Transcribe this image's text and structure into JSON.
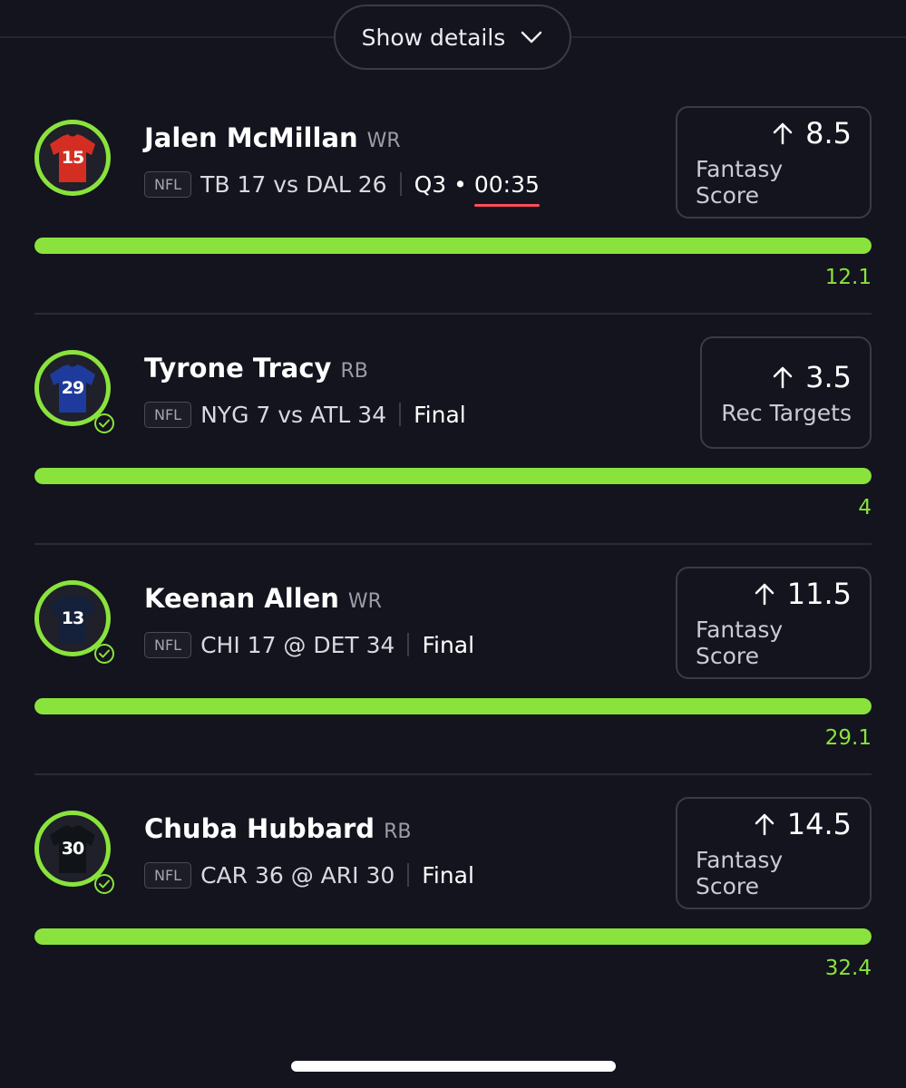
{
  "header": {
    "details_label": "Show details"
  },
  "colors": {
    "accent": "#8ae33c",
    "background": "#13141d",
    "live_indicator": "#ff4d5a"
  },
  "picks": [
    {
      "name": "Jalen McMillan",
      "position": "WR",
      "league": "NFL",
      "matchup": "TB 17 vs DAL 26",
      "status_period": "Q3 •",
      "status_time": "00:35",
      "status": "",
      "line_value": "8.5",
      "stat": "Fantasy Score",
      "actual": "12.1",
      "jersey_number": "15",
      "jersey_color": "#d42e22",
      "settled": false,
      "progress": 1.0
    },
    {
      "name": "Tyrone Tracy",
      "position": "RB",
      "league": "NFL",
      "matchup": "NYG 7 vs ATL 34",
      "status": "Final",
      "line_value": "3.5",
      "stat": "Rec Targets",
      "actual": "4",
      "jersey_number": "29",
      "jersey_color": "#1e3a9c",
      "settled": true,
      "progress": 1.0
    },
    {
      "name": "Keenan Allen",
      "position": "WR",
      "league": "NFL",
      "matchup": "CHI 17 @ DET 34",
      "status": "Final",
      "line_value": "11.5",
      "stat": "Fantasy Score",
      "actual": "29.1",
      "jersey_number": "13",
      "jersey_color": "#15203a",
      "settled": true,
      "progress": 1.0
    },
    {
      "name": "Chuba Hubbard",
      "position": "RB",
      "league": "NFL",
      "matchup": "CAR 36 @ ARI 30",
      "status": "Final",
      "line_value": "14.5",
      "stat": "Fantasy Score",
      "actual": "32.4",
      "jersey_number": "30",
      "jersey_color": "#101418",
      "settled": true,
      "progress": 1.0
    }
  ]
}
